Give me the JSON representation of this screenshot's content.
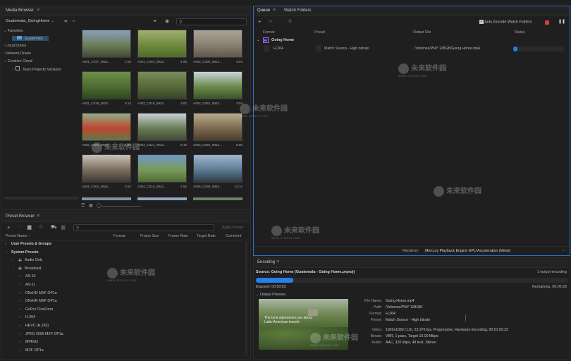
{
  "media_browser": {
    "tab_label": "Media Browser",
    "project_selector": "Guatemala_GoingHome",
    "tree": {
      "favorites": "Favorites",
      "favorite_folder": "Guatemala",
      "local_drives": "Local Drives",
      "network_drives": "Network Drives",
      "creative_cloud": "Creative Cloud",
      "team_projects": "Team Projects Versions"
    },
    "thumbnails": [
      {
        "name": "A001_C037_0921...",
        "duration": "2:08",
        "colors": [
          "#8aa0b8",
          "#6d7d5a",
          "#3f4a32"
        ]
      },
      {
        "name": "A001_C064_0922...",
        "duration": "4:08",
        "colors": [
          "#9fb070",
          "#6f8a3d",
          "#4f6a2a"
        ]
      },
      {
        "name": "A002_C009_0922...",
        "duration": "3:04",
        "colors": [
          "#a9a59a",
          "#8a8070",
          "#5f584c"
        ]
      },
      {
        "name": "A002_C018_0922...",
        "duration": "8:13",
        "colors": [
          "#6f8f4a",
          "#4d6d33",
          "#2e4620"
        ]
      },
      {
        "name": "A002_C018_0922...",
        "duration": "3:02",
        "colors": [
          "#7a8d5a",
          "#566a3a",
          "#34452a"
        ]
      },
      {
        "name": "A002_C052_0922...",
        "duration": "3:04",
        "colors": [
          "#c8d4dc",
          "#6b8a4a",
          "#3d5428"
        ]
      },
      {
        "name": "A002_C086_0922...",
        "duration": "4:04",
        "colors": [
          "#8fb08a",
          "#c0452f",
          "#5f7a4a"
        ]
      },
      {
        "name": "A004_C021_0923...",
        "duration": "6:18",
        "colors": [
          "#c9d0d6",
          "#6b7d58",
          "#3f4a36"
        ]
      },
      {
        "name": "A003_C092_0922...",
        "duration": "6:08",
        "colors": [
          "#b9ab8f",
          "#7d6a4f",
          "#4a3d2c"
        ]
      },
      {
        "name": "A004_C002_0924...",
        "duration": "3:02",
        "colors": [
          "#c7c1b6",
          "#7a6d60",
          "#3f3832"
        ]
      },
      {
        "name": "A004_C010_0924...",
        "duration": "2:06",
        "colors": [
          "#6f98c4",
          "#7a9a5a",
          "#4d6a36"
        ]
      },
      {
        "name": "A005_C039_0925...",
        "duration": "13:14",
        "colors": [
          "#9fb6cf",
          "#5d7a94",
          "#2f3d46"
        ]
      }
    ]
  },
  "preset_browser": {
    "tab_label": "Preset Browser",
    "apply_preset": "Apply Preset",
    "columns": {
      "name": "Preset Name",
      "sort_arrow": "↑",
      "format": "Format",
      "frame_size": "Frame Size",
      "frame_rate": "Frame Rate",
      "target_rate": "Target Rate",
      "comment": "Comment"
    },
    "rows": [
      {
        "label": "User Presets & Groups",
        "level": 0,
        "bold": true,
        "caret": "›"
      },
      {
        "label": "System Presets",
        "level": 0,
        "bold": true,
        "caret": "⌄"
      },
      {
        "label": "Audio Only",
        "level": 1,
        "bold": false,
        "caret": "›",
        "icon": "audio"
      },
      {
        "label": "Broadcast",
        "level": 1,
        "bold": false,
        "caret": "⌄",
        "icon": "tv"
      },
      {
        "label": "AS-10",
        "level": 2,
        "bold": false,
        "caret": "›"
      },
      {
        "label": "AS-11",
        "level": 2,
        "bold": false,
        "caret": "›"
      },
      {
        "label": "DNxHD MXF OP1a",
        "level": 2,
        "bold": false,
        "caret": "›"
      },
      {
        "label": "DNxHR MXF OP1a",
        "level": 2,
        "bold": false,
        "caret": "›"
      },
      {
        "label": "GoPro CineForm",
        "level": 2,
        "bold": false,
        "caret": "›"
      },
      {
        "label": "H.264",
        "level": 2,
        "bold": false,
        "caret": "›"
      },
      {
        "label": "HEVC (H.265)",
        "level": 2,
        "bold": false,
        "caret": "›"
      },
      {
        "label": "JPEG 2000 MXF OP1a",
        "level": 2,
        "bold": false,
        "caret": "›"
      },
      {
        "label": "MPEG2",
        "level": 2,
        "bold": false,
        "caret": "›"
      },
      {
        "label": "MXF OP1a",
        "level": 2,
        "bold": false,
        "caret": "›"
      }
    ]
  },
  "queue": {
    "tab_queue": "Queue",
    "tab_watch": "Watch Folders",
    "auto_encode_label": "Auto-Encode Watch Folders",
    "columns": {
      "format": "Format",
      "preset": "Preset",
      "output_file": "Output File",
      "status": "Status"
    },
    "group_name": "Going Home",
    "item": {
      "format": "H.264",
      "preset": "Match Source - High bitrate",
      "output": "/Volumes/PNY 128GB/Going Home.mp4",
      "progress": 0.08
    },
    "renderer_label": "Renderer:",
    "renderer_value": "Mercury Playback Engine GPU Acceleration (Metal)"
  },
  "encoding": {
    "tab_label": "Encoding",
    "source": "Source: Going Home (Guatemala - Going Home.prproj)",
    "output_count": "1 output encoding",
    "elapsed": "Elapsed: 00:00:02",
    "remaining": "Remaining: 00:00:28",
    "progress": 0.12,
    "output_preview_label": "Output Preview",
    "preview_caption": "The best adventures are about\nLatin-American travels",
    "details": [
      {
        "label": "File Name:",
        "value": "Going Home.mp4"
      },
      {
        "label": "Path:",
        "value": "/Volumes/PNY 128GB/"
      },
      {
        "label": "Format:",
        "value": "H.264"
      },
      {
        "label": "Preset:",
        "value": "Match Source - High bitrate"
      },
      {
        "label": "Video:",
        "value": "1920x1080 (1.0), 23.976 fps, Progressive, Hardware Encoding, 00:01:02:23"
      },
      {
        "label": "Bitrate:",
        "value": "VBR, 1 pass, Target 10.00 Mbps"
      },
      {
        "label": "Audio:",
        "value": "AAC, 320 kbps, 48 kHz, Stereo"
      }
    ]
  },
  "watermark": {
    "brand": "未来软件园",
    "url": "www.orsoon.com"
  },
  "colors": {
    "accent": "#2680eb",
    "record": "#e03b2f",
    "bg": "#1f1f1f"
  }
}
